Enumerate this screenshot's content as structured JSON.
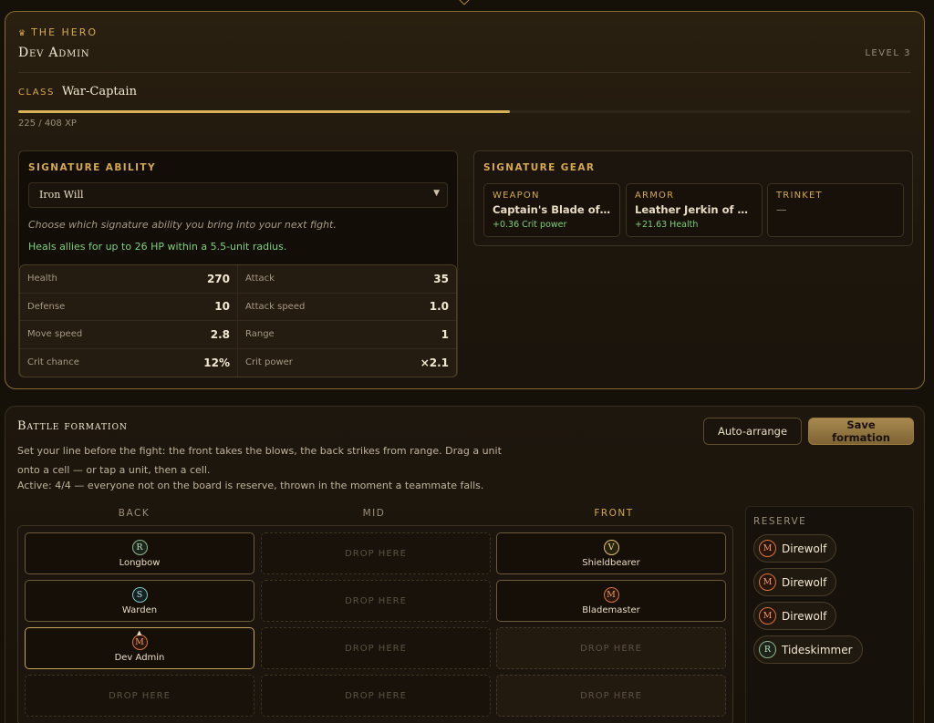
{
  "hero": {
    "eyebrow": "THE HERO",
    "name": "Dev Admin",
    "level": "LEVEL 3",
    "class_label": "CLASS",
    "class_value": "War-Captain",
    "xp_text": "225 / 408 XP",
    "xp_fraction": 0.551
  },
  "ability": {
    "title": "SIGNATURE ABILITY",
    "selected": "Iron Will",
    "hint": "Choose which signature ability you bring into your next fight.",
    "description": "Heals allies for up to 26 HP within a 5.5-unit radius."
  },
  "stats": [
    {
      "label": "Health",
      "value": "270"
    },
    {
      "label": "Attack",
      "value": "35"
    },
    {
      "label": "Defense",
      "value": "10"
    },
    {
      "label": "Attack speed",
      "value": "1.0"
    },
    {
      "label": "Move speed",
      "value": "2.8"
    },
    {
      "label": "Range",
      "value": "1"
    },
    {
      "label": "Crit chance",
      "value": "12%"
    },
    {
      "label": "Crit power",
      "value": "×2.1"
    }
  ],
  "gear": {
    "title": "SIGNATURE GEAR",
    "slots": [
      {
        "type": "WEAPON",
        "name": "Captain's Blade of ...",
        "stat": "+0.36 Crit power"
      },
      {
        "type": "ARMOR",
        "name": "Leather Jerkin of V...",
        "stat": "+21.63 Health"
      },
      {
        "type": "TRINKET",
        "name": "—",
        "stat": ""
      }
    ]
  },
  "formation": {
    "title": "Battle formation",
    "help": "Set your line before the fight: the front takes the blows, the back strikes from range. Drag a unit onto a cell — or tap a unit, then a cell.",
    "active": "Active: 4/4 — everyone not on the board is reserve, thrown in the moment a teammate falls.",
    "auto_arrange": "Auto-arrange",
    "save": "Save formation",
    "columns": [
      "BACK",
      "MID",
      "FRONT"
    ],
    "drop_label": "DROP HERE",
    "cells": {
      "back": [
        {
          "letter": "R",
          "name": "Longbow"
        },
        {
          "letter": "S",
          "name": "Warden"
        },
        {
          "letter": "M",
          "name": "Dev Admin"
        },
        null
      ],
      "front": [
        {
          "letter": "V",
          "name": "Shieldbearer"
        },
        {
          "letter": "M",
          "name": "Blademaster"
        },
        null,
        null
      ]
    }
  },
  "reserve": {
    "title": "RESERVE",
    "units": [
      {
        "letter": "M",
        "name": "Direwolf"
      },
      {
        "letter": "M",
        "name": "Direwolf"
      },
      {
        "letter": "M",
        "name": "Direwolf"
      },
      {
        "letter": "R",
        "name": "Tideskimmer"
      }
    ]
  },
  "colors": {
    "accent_gold": "#d4a94e",
    "positive_green": "#7fcf7a",
    "melee_orange": "#d8743c"
  }
}
